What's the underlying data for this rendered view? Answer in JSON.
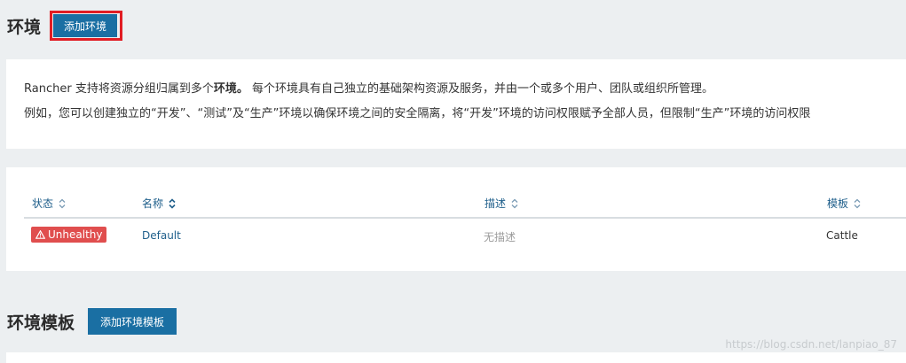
{
  "environments": {
    "title": "环境",
    "add_button": "添加环境"
  },
  "info": {
    "line1_pre": "Rancher 支持将资源分组归属到多个",
    "line1_bold": "环境。",
    "line1_post": " 每个环境具有自己独立的基础架构资源及服务，并由一个或多个用户、团队或组织所管理。",
    "line2": "例如，您可以创建独立的“开发”、“测试”及“生产”环境以确保环境之间的安全隔离，将“开发”环境的访问权限赋予全部人员，但限制“生产”环境的访问权限"
  },
  "table": {
    "columns": [
      "状态",
      "名称",
      "描述",
      "模板"
    ],
    "rows": [
      {
        "status": "Unhealthy",
        "name": "Default",
        "description": "无描述",
        "template": "Cattle"
      }
    ]
  },
  "templates": {
    "title": "环境模板",
    "add_button": "添加环境模板"
  },
  "watermark": "https://blog.csdn.net/lanpiao_87",
  "colors": {
    "primary": "#1a6fa3",
    "danger": "#e04e4e",
    "highlight": "#e11d24",
    "link": "#1f5f8b"
  }
}
